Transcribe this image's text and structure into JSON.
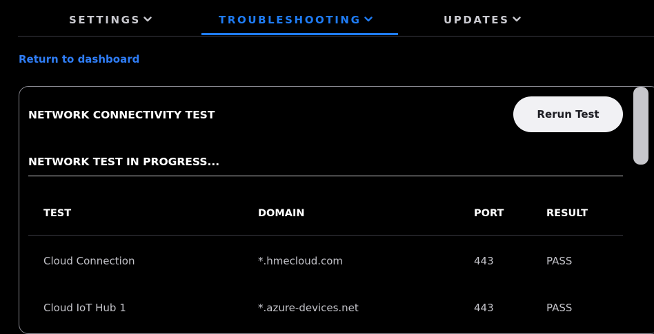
{
  "nav": {
    "items": [
      {
        "label": "SETTINGS",
        "active": false
      },
      {
        "label": "TROUBLESHOOTING",
        "active": true
      },
      {
        "label": "UPDATES",
        "active": false
      }
    ],
    "accent_color": "#1f7cf5"
  },
  "return_link": "Return to dashboard",
  "panel": {
    "title": "NETWORK CONNECTIVITY TEST",
    "rerun_label": "Rerun Test",
    "status": "NETWORK TEST IN PROGRESS...",
    "table": {
      "headers": [
        "TEST",
        "DOMAIN",
        "PORT",
        "RESULT"
      ],
      "rows": [
        [
          "Cloud Connection",
          "*.hmecloud.com",
          "443",
          "PASS"
        ],
        [
          "Cloud IoT Hub 1",
          "*.azure-devices.net",
          "443",
          "PASS"
        ]
      ]
    }
  }
}
